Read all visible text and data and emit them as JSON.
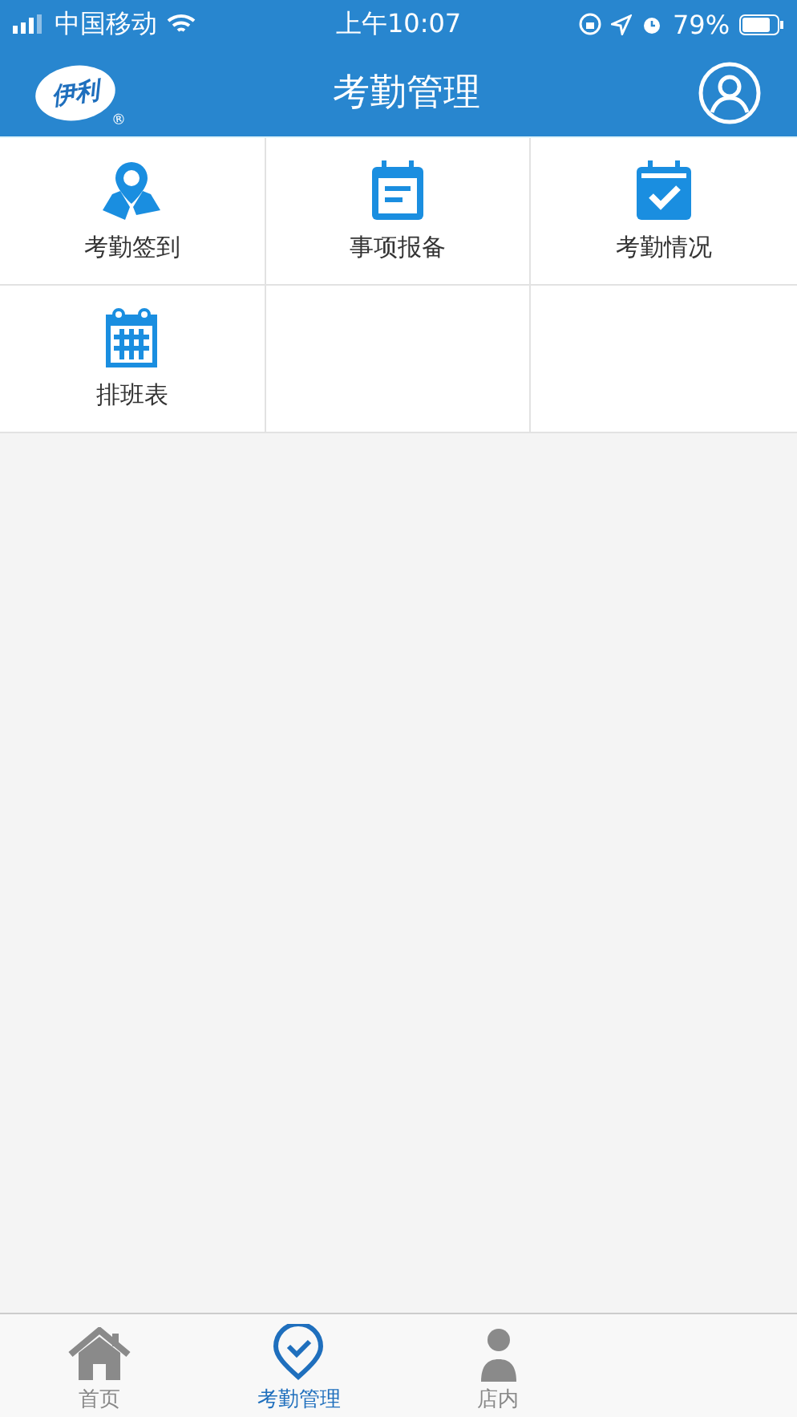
{
  "status_bar": {
    "carrier": "中国移动",
    "time": "上午10:07",
    "battery_text": "79%"
  },
  "header": {
    "logo_text": "伊利",
    "logo_mark": "®",
    "title": "考勤管理"
  },
  "grid": [
    {
      "kind": "pin",
      "label": "考勤签到"
    },
    {
      "kind": "note",
      "label": "事项报备"
    },
    {
      "kind": "check",
      "label": "考勤情况"
    },
    {
      "kind": "schedule",
      "label": "排班表"
    }
  ],
  "tab_bar": [
    {
      "kind": "home",
      "label": "首页",
      "selected": false
    },
    {
      "kind": "check",
      "label": "考勤管理",
      "selected": true
    },
    {
      "kind": "store",
      "label": "店内",
      "selected": false
    }
  ]
}
